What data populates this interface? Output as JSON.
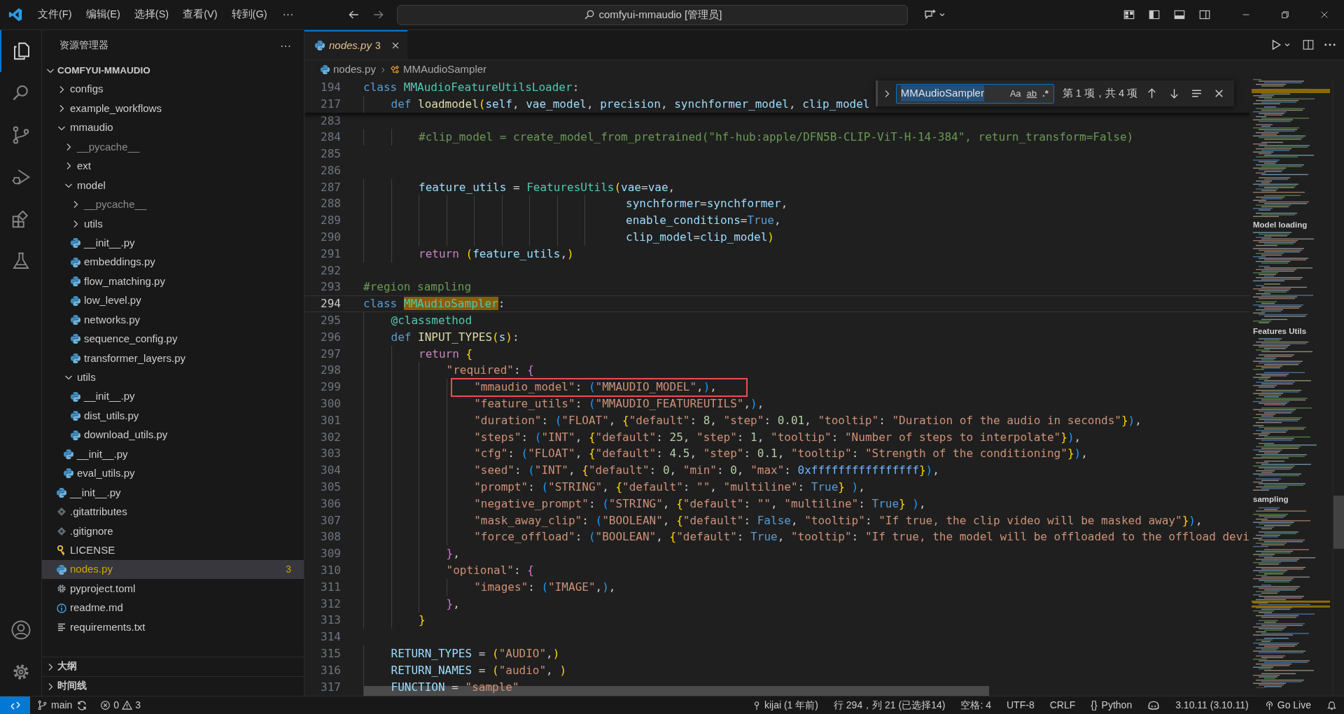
{
  "title_bar": {
    "menus": [
      "文件(F)",
      "编辑(E)",
      "选择(S)",
      "查看(V)",
      "转到(G)"
    ],
    "more": "···",
    "command_center": "comfyui-mmaudio [管理员]"
  },
  "explorer": {
    "title": "资源管理器",
    "more": "···",
    "root": {
      "label": "COMFYUI-MMAUDIO",
      "expanded": true
    },
    "tree": [
      {
        "label": "configs",
        "kind": "folder",
        "expanded": false,
        "dimmed": false,
        "selected": false
      },
      {
        "label": "example_workflows",
        "kind": "folder",
        "expanded": false,
        "dimmed": false,
        "selected": false
      },
      {
        "label": "mmaudio",
        "kind": "folder",
        "expanded": true,
        "dimmed": false,
        "selected": false,
        "children": [
          {
            "label": "__pycache__",
            "kind": "folder",
            "expanded": false,
            "dimmed": true,
            "selected": false
          },
          {
            "label": "ext",
            "kind": "folder",
            "expanded": false,
            "dimmed": false,
            "selected": false
          },
          {
            "label": "model",
            "kind": "folder",
            "expanded": true,
            "dimmed": false,
            "selected": false,
            "children": [
              {
                "label": "__pycache__",
                "kind": "folder",
                "expanded": false,
                "dimmed": true,
                "selected": false
              },
              {
                "label": "utils",
                "kind": "folder",
                "expanded": false,
                "dimmed": false,
                "selected": false
              },
              {
                "label": "__init__.py",
                "kind": "python",
                "dimmed": false,
                "selected": false
              },
              {
                "label": "embeddings.py",
                "kind": "python",
                "dimmed": false,
                "selected": false
              },
              {
                "label": "flow_matching.py",
                "kind": "python",
                "dimmed": false,
                "selected": false
              },
              {
                "label": "low_level.py",
                "kind": "python",
                "dimmed": false,
                "selected": false
              },
              {
                "label": "networks.py",
                "kind": "python",
                "dimmed": false,
                "selected": false
              },
              {
                "label": "sequence_config.py",
                "kind": "python",
                "dimmed": false,
                "selected": false
              },
              {
                "label": "transformer_layers.py",
                "kind": "python",
                "dimmed": false,
                "selected": false
              }
            ]
          },
          {
            "label": "utils",
            "kind": "folder",
            "expanded": true,
            "dimmed": false,
            "selected": false,
            "children": [
              {
                "label": "__init__.py",
                "kind": "python",
                "dimmed": false,
                "selected": false
              },
              {
                "label": "dist_utils.py",
                "kind": "python",
                "dimmed": false,
                "selected": false
              },
              {
                "label": "download_utils.py",
                "kind": "python",
                "dimmed": false,
                "selected": false
              }
            ]
          },
          {
            "label": "__init__.py",
            "kind": "python",
            "dimmed": false,
            "selected": false
          },
          {
            "label": "eval_utils.py",
            "kind": "python",
            "dimmed": false,
            "selected": false
          }
        ]
      },
      {
        "label": "__init__.py",
        "kind": "python",
        "dimmed": false,
        "selected": false
      },
      {
        "label": ".gitattributes",
        "kind": "git",
        "dimmed": false,
        "selected": false
      },
      {
        "label": ".gitignore",
        "kind": "git",
        "dimmed": false,
        "selected": false
      },
      {
        "label": "LICENSE",
        "kind": "license",
        "dimmed": false,
        "selected": false
      },
      {
        "label": "nodes.py",
        "kind": "python",
        "dimmed": false,
        "selected": true,
        "badge": "3"
      },
      {
        "label": "pyproject.toml",
        "kind": "config",
        "dimmed": false,
        "selected": false
      },
      {
        "label": "readme.md",
        "kind": "info",
        "dimmed": false,
        "selected": false
      },
      {
        "label": "requirements.txt",
        "kind": "text",
        "dimmed": false,
        "selected": false
      }
    ],
    "sections": [
      {
        "label": "大纲",
        "expanded": false
      },
      {
        "label": "时间线",
        "expanded": false
      }
    ]
  },
  "tabs": [
    {
      "label": "nodes.py",
      "count": "3",
      "preview": true,
      "selected": true
    }
  ],
  "breadcrumb": [
    {
      "label": "nodes.py",
      "kind": "file"
    },
    {
      "label": "MMAudioSampler",
      "kind": "class"
    }
  ],
  "find_widget": {
    "query": "MMAudioSampler",
    "query_selected": true,
    "options": [
      "Aa",
      "ab",
      ".*"
    ],
    "result": "第 1 项，共 4 项"
  },
  "editor": {
    "sticky_lines": [
      {
        "number": "194",
        "active": false,
        "tokens": [
          {
            "kind": "kw",
            "text": "class "
          },
          {
            "kind": "type",
            "text": "MMAudioFeatureUtilsLoader"
          },
          {
            "kind": "pun",
            "text": ":"
          }
        ]
      },
      {
        "number": "217",
        "active": false,
        "tokens": [
          {
            "kind": "kw",
            "text": "    def "
          },
          {
            "kind": "fn",
            "text": "loadmodel"
          },
          {
            "kind": "br1",
            "text": "("
          },
          {
            "kind": "var",
            "text": "self"
          },
          {
            "kind": "pun",
            "text": ", "
          },
          {
            "kind": "var",
            "text": "vae_model"
          },
          {
            "kind": "pun",
            "text": ", "
          },
          {
            "kind": "var",
            "text": "precision"
          },
          {
            "kind": "pun",
            "text": ", "
          },
          {
            "kind": "var",
            "text": "synchformer_model"
          },
          {
            "kind": "pun",
            "text": ", "
          },
          {
            "kind": "var",
            "text": "clip_model"
          }
        ]
      }
    ],
    "lines": [
      {
        "number": "283",
        "active": false
      },
      {
        "number": "284",
        "active": false,
        "tokens": [
          {
            "kind": "com",
            "text": "        #clip_model = create_model_from_pretrained(\"hf-hub:apple/DFN5B-CLIP-ViT-H-14-384\", return_transform=False)"
          }
        ]
      },
      {
        "number": "285",
        "active": false
      },
      {
        "number": "286",
        "active": false
      },
      {
        "number": "287",
        "active": false,
        "tokens": [
          {
            "kind": "var",
            "text": "        feature_utils"
          },
          {
            "kind": "pun",
            "text": " = "
          },
          {
            "kind": "type",
            "text": "FeaturesUtils"
          },
          {
            "kind": "br1",
            "text": "("
          },
          {
            "kind": "var",
            "text": "vae"
          },
          {
            "kind": "pun",
            "text": "="
          },
          {
            "kind": "var",
            "text": "vae"
          },
          {
            "kind": "pun",
            "text": ","
          }
        ]
      },
      {
        "number": "288",
        "active": false,
        "tokens": [
          {
            "kind": "var",
            "text": "                                      synchformer"
          },
          {
            "kind": "pun",
            "text": "="
          },
          {
            "kind": "var",
            "text": "synchformer"
          },
          {
            "kind": "pun",
            "text": ","
          }
        ]
      },
      {
        "number": "289",
        "active": false,
        "tokens": [
          {
            "kind": "var",
            "text": "                                      enable_conditions"
          },
          {
            "kind": "pun",
            "text": "="
          },
          {
            "kind": "kw",
            "text": "True"
          },
          {
            "kind": "pun",
            "text": ","
          }
        ]
      },
      {
        "number": "290",
        "active": false,
        "tokens": [
          {
            "kind": "var",
            "text": "                                      clip_model"
          },
          {
            "kind": "pun",
            "text": "="
          },
          {
            "kind": "var",
            "text": "clip_model"
          },
          {
            "kind": "br1",
            "text": ")"
          }
        ]
      },
      {
        "number": "291",
        "active": false,
        "tokens": [
          {
            "kind": "ctl",
            "text": "        return "
          },
          {
            "kind": "br1",
            "text": "("
          },
          {
            "kind": "var",
            "text": "feature_utils"
          },
          {
            "kind": "pun",
            "text": ","
          },
          {
            "kind": "br1",
            "text": ")"
          }
        ]
      },
      {
        "number": "292",
        "active": false
      },
      {
        "number": "293",
        "active": false,
        "tokens": [
          {
            "kind": "com",
            "text": "#region sampling"
          }
        ]
      },
      {
        "number": "294",
        "active": true,
        "tokens": [
          {
            "kind": "kw",
            "text": "class "
          },
          {
            "kind": "match",
            "text": "MMAudioSampler"
          },
          {
            "kind": "pun",
            "text": ":"
          }
        ]
      },
      {
        "number": "295",
        "active": false,
        "tokens": [
          {
            "kind": "type",
            "text": "    @classmethod"
          }
        ]
      },
      {
        "number": "296",
        "active": false,
        "tokens": [
          {
            "kind": "kw",
            "text": "    def "
          },
          {
            "kind": "fn",
            "text": "INPUT_TYPES"
          },
          {
            "kind": "br1",
            "text": "("
          },
          {
            "kind": "var",
            "text": "s"
          },
          {
            "kind": "br1",
            "text": ")"
          },
          {
            "kind": "pun",
            "text": ":"
          }
        ]
      },
      {
        "number": "297",
        "active": false,
        "tokens": [
          {
            "kind": "ctl",
            "text": "        return "
          },
          {
            "kind": "br1",
            "text": "{"
          }
        ]
      },
      {
        "number": "298",
        "active": false,
        "tokens": [
          {
            "kind": "str",
            "text": "            \"required\""
          },
          {
            "kind": "pun",
            "text": ": "
          },
          {
            "kind": "br2",
            "text": "{"
          }
        ]
      },
      {
        "number": "299",
        "active": false,
        "tokens": [
          {
            "kind": "str",
            "text": "                \"mmaudio_model\""
          },
          {
            "kind": "pun",
            "text": ": "
          },
          {
            "kind": "br3",
            "text": "("
          },
          {
            "kind": "str",
            "text": "\"MMAUDIO_MODEL\""
          },
          {
            "kind": "pun",
            "text": ","
          },
          {
            "kind": "br3",
            "text": ")"
          },
          {
            "kind": "pun",
            "text": ","
          }
        ]
      },
      {
        "number": "300",
        "active": false,
        "tokens": [
          {
            "kind": "str",
            "text": "                \"feature_utils\""
          },
          {
            "kind": "pun",
            "text": ": "
          },
          {
            "kind": "br3",
            "text": "("
          },
          {
            "kind": "str",
            "text": "\"MMAUDIO_FEATUREUTILS\""
          },
          {
            "kind": "pun",
            "text": ","
          },
          {
            "kind": "br3",
            "text": ")"
          },
          {
            "kind": "pun",
            "text": ","
          }
        ]
      },
      {
        "number": "301",
        "active": false,
        "tokens": [
          {
            "kind": "str",
            "text": "                \"duration\""
          },
          {
            "kind": "pun",
            "text": ": "
          },
          {
            "kind": "br3",
            "text": "("
          },
          {
            "kind": "str",
            "text": "\"FLOAT\""
          },
          {
            "kind": "pun",
            "text": ", "
          },
          {
            "kind": "br1",
            "text": "{"
          },
          {
            "kind": "str",
            "text": "\"default\""
          },
          {
            "kind": "pun",
            "text": ": "
          },
          {
            "kind": "num",
            "text": "8"
          },
          {
            "kind": "pun",
            "text": ", "
          },
          {
            "kind": "str",
            "text": "\"step\""
          },
          {
            "kind": "pun",
            "text": ": "
          },
          {
            "kind": "num",
            "text": "0.01"
          },
          {
            "kind": "pun",
            "text": ", "
          },
          {
            "kind": "str",
            "text": "\"tooltip\""
          },
          {
            "kind": "pun",
            "text": ": "
          },
          {
            "kind": "str",
            "text": "\"Duration of the audio in seconds\""
          },
          {
            "kind": "br1",
            "text": "}"
          },
          {
            "kind": "br3",
            "text": ")"
          },
          {
            "kind": "pun",
            "text": ","
          }
        ]
      },
      {
        "number": "302",
        "active": false,
        "tokens": [
          {
            "kind": "str",
            "text": "                \"steps\""
          },
          {
            "kind": "pun",
            "text": ": "
          },
          {
            "kind": "br3",
            "text": "("
          },
          {
            "kind": "str",
            "text": "\"INT\""
          },
          {
            "kind": "pun",
            "text": ", "
          },
          {
            "kind": "br1",
            "text": "{"
          },
          {
            "kind": "str",
            "text": "\"default\""
          },
          {
            "kind": "pun",
            "text": ": "
          },
          {
            "kind": "num",
            "text": "25"
          },
          {
            "kind": "pun",
            "text": ", "
          },
          {
            "kind": "str",
            "text": "\"step\""
          },
          {
            "kind": "pun",
            "text": ": "
          },
          {
            "kind": "num",
            "text": "1"
          },
          {
            "kind": "pun",
            "text": ", "
          },
          {
            "kind": "str",
            "text": "\"tooltip\""
          },
          {
            "kind": "pun",
            "text": ": "
          },
          {
            "kind": "str",
            "text": "\"Number of steps to interpolate\""
          },
          {
            "kind": "br1",
            "text": "}"
          },
          {
            "kind": "br3",
            "text": ")"
          },
          {
            "kind": "pun",
            "text": ","
          }
        ]
      },
      {
        "number": "303",
        "active": false,
        "tokens": [
          {
            "kind": "str",
            "text": "                \"cfg\""
          },
          {
            "kind": "pun",
            "text": ": "
          },
          {
            "kind": "br3",
            "text": "("
          },
          {
            "kind": "str",
            "text": "\"FLOAT\""
          },
          {
            "kind": "pun",
            "text": ", "
          },
          {
            "kind": "br1",
            "text": "{"
          },
          {
            "kind": "str",
            "text": "\"default\""
          },
          {
            "kind": "pun",
            "text": ": "
          },
          {
            "kind": "num",
            "text": "4.5"
          },
          {
            "kind": "pun",
            "text": ", "
          },
          {
            "kind": "str",
            "text": "\"step\""
          },
          {
            "kind": "pun",
            "text": ": "
          },
          {
            "kind": "num",
            "text": "0.1"
          },
          {
            "kind": "pun",
            "text": ", "
          },
          {
            "kind": "str",
            "text": "\"tooltip\""
          },
          {
            "kind": "pun",
            "text": ": "
          },
          {
            "kind": "str",
            "text": "\"Strength of the conditioning\""
          },
          {
            "kind": "br1",
            "text": "}"
          },
          {
            "kind": "br3",
            "text": ")"
          },
          {
            "kind": "pun",
            "text": ","
          }
        ]
      },
      {
        "number": "304",
        "active": false,
        "tokens": [
          {
            "kind": "str",
            "text": "                \"seed\""
          },
          {
            "kind": "pun",
            "text": ": "
          },
          {
            "kind": "br3",
            "text": "("
          },
          {
            "kind": "str",
            "text": "\"INT\""
          },
          {
            "kind": "pun",
            "text": ", "
          },
          {
            "kind": "br1",
            "text": "{"
          },
          {
            "kind": "str",
            "text": "\"default\""
          },
          {
            "kind": "pun",
            "text": ": "
          },
          {
            "kind": "num",
            "text": "0"
          },
          {
            "kind": "pun",
            "text": ", "
          },
          {
            "kind": "str",
            "text": "\"min\""
          },
          {
            "kind": "pun",
            "text": ": "
          },
          {
            "kind": "num",
            "text": "0"
          },
          {
            "kind": "pun",
            "text": ", "
          },
          {
            "kind": "str",
            "text": "\"max\""
          },
          {
            "kind": "pun",
            "text": ": "
          },
          {
            "kind": "hex",
            "text": "0xffffffffffffffff"
          },
          {
            "kind": "br1",
            "text": "}"
          },
          {
            "kind": "br3",
            "text": ")"
          },
          {
            "kind": "pun",
            "text": ","
          }
        ]
      },
      {
        "number": "305",
        "active": false,
        "tokens": [
          {
            "kind": "str",
            "text": "                \"prompt\""
          },
          {
            "kind": "pun",
            "text": ": "
          },
          {
            "kind": "br3",
            "text": "("
          },
          {
            "kind": "str",
            "text": "\"STRING\""
          },
          {
            "kind": "pun",
            "text": ", "
          },
          {
            "kind": "br1",
            "text": "{"
          },
          {
            "kind": "str",
            "text": "\"default\""
          },
          {
            "kind": "pun",
            "text": ": "
          },
          {
            "kind": "str",
            "text": "\"\""
          },
          {
            "kind": "pun",
            "text": ", "
          },
          {
            "kind": "str",
            "text": "\"multiline\""
          },
          {
            "kind": "pun",
            "text": ": "
          },
          {
            "kind": "kw",
            "text": "True"
          },
          {
            "kind": "br1",
            "text": "}"
          },
          {
            "kind": "br3",
            "text": " )"
          },
          {
            "kind": "pun",
            "text": ","
          }
        ]
      },
      {
        "number": "306",
        "active": false,
        "tokens": [
          {
            "kind": "str",
            "text": "                \"negative_prompt\""
          },
          {
            "kind": "pun",
            "text": ": "
          },
          {
            "kind": "br3",
            "text": "("
          },
          {
            "kind": "str",
            "text": "\"STRING\""
          },
          {
            "kind": "pun",
            "text": ", "
          },
          {
            "kind": "br1",
            "text": "{"
          },
          {
            "kind": "str",
            "text": "\"default\""
          },
          {
            "kind": "pun",
            "text": ": "
          },
          {
            "kind": "str",
            "text": "\"\""
          },
          {
            "kind": "pun",
            "text": ", "
          },
          {
            "kind": "str",
            "text": "\"multiline\""
          },
          {
            "kind": "pun",
            "text": ": "
          },
          {
            "kind": "kw",
            "text": "True"
          },
          {
            "kind": "br1",
            "text": "}"
          },
          {
            "kind": "br3",
            "text": " )"
          },
          {
            "kind": "pun",
            "text": ","
          }
        ]
      },
      {
        "number": "307",
        "active": false,
        "tokens": [
          {
            "kind": "str",
            "text": "                \"mask_away_clip\""
          },
          {
            "kind": "pun",
            "text": ": "
          },
          {
            "kind": "br3",
            "text": "("
          },
          {
            "kind": "str",
            "text": "\"BOOLEAN\""
          },
          {
            "kind": "pun",
            "text": ", "
          },
          {
            "kind": "br1",
            "text": "{"
          },
          {
            "kind": "str",
            "text": "\"default\""
          },
          {
            "kind": "pun",
            "text": ": "
          },
          {
            "kind": "kw",
            "text": "False"
          },
          {
            "kind": "pun",
            "text": ", "
          },
          {
            "kind": "str",
            "text": "\"tooltip\""
          },
          {
            "kind": "pun",
            "text": ": "
          },
          {
            "kind": "str",
            "text": "\"If true, the clip video will be masked away\""
          },
          {
            "kind": "br1",
            "text": "}"
          },
          {
            "kind": "br3",
            "text": ")"
          },
          {
            "kind": "pun",
            "text": ","
          }
        ]
      },
      {
        "number": "308",
        "active": false,
        "tokens": [
          {
            "kind": "str",
            "text": "                \"force_offload\""
          },
          {
            "kind": "pun",
            "text": ": "
          },
          {
            "kind": "br3",
            "text": "("
          },
          {
            "kind": "str",
            "text": "\"BOOLEAN\""
          },
          {
            "kind": "pun",
            "text": ", "
          },
          {
            "kind": "br1",
            "text": "{"
          },
          {
            "kind": "str",
            "text": "\"default\""
          },
          {
            "kind": "pun",
            "text": ": "
          },
          {
            "kind": "kw",
            "text": "True"
          },
          {
            "kind": "pun",
            "text": ", "
          },
          {
            "kind": "str",
            "text": "\"tooltip\""
          },
          {
            "kind": "pun",
            "text": ": "
          },
          {
            "kind": "str",
            "text": "\"If true, the model will be offloaded to the offload devi"
          }
        ]
      },
      {
        "number": "309",
        "active": false,
        "tokens": [
          {
            "kind": "br2",
            "text": "            }"
          },
          {
            "kind": "pun",
            "text": ","
          }
        ]
      },
      {
        "number": "310",
        "active": false,
        "tokens": [
          {
            "kind": "str",
            "text": "            \"optional\""
          },
          {
            "kind": "pun",
            "text": ": "
          },
          {
            "kind": "br2",
            "text": "{"
          }
        ]
      },
      {
        "number": "311",
        "active": false,
        "tokens": [
          {
            "kind": "str",
            "text": "                \"images\""
          },
          {
            "kind": "pun",
            "text": ": "
          },
          {
            "kind": "br3",
            "text": "("
          },
          {
            "kind": "str",
            "text": "\"IMAGE\""
          },
          {
            "kind": "pun",
            "text": ","
          },
          {
            "kind": "br3",
            "text": ")"
          },
          {
            "kind": "pun",
            "text": ","
          }
        ]
      },
      {
        "number": "312",
        "active": false,
        "tokens": [
          {
            "kind": "br2",
            "text": "            }"
          },
          {
            "kind": "pun",
            "text": ","
          }
        ]
      },
      {
        "number": "313",
        "active": false,
        "tokens": [
          {
            "kind": "br1",
            "text": "        }"
          }
        ]
      },
      {
        "number": "314",
        "active": false
      },
      {
        "number": "315",
        "active": false,
        "tokens": [
          {
            "kind": "var",
            "text": "    RETURN_TYPES"
          },
          {
            "kind": "pun",
            "text": " = "
          },
          {
            "kind": "br1",
            "text": "("
          },
          {
            "kind": "str",
            "text": "\"AUDIO\""
          },
          {
            "kind": "pun",
            "text": ","
          },
          {
            "kind": "br1",
            "text": ")"
          }
        ]
      },
      {
        "number": "316",
        "active": false,
        "tokens": [
          {
            "kind": "var",
            "text": "    RETURN_NAMES"
          },
          {
            "kind": "pun",
            "text": " = "
          },
          {
            "kind": "br1",
            "text": "("
          },
          {
            "kind": "str",
            "text": "\"audio\""
          },
          {
            "kind": "pun",
            "text": ", "
          },
          {
            "kind": "br1",
            "text": ")"
          }
        ]
      },
      {
        "number": "317",
        "active": false,
        "tokens": [
          {
            "kind": "var",
            "text": "    FUNCTION"
          },
          {
            "kind": "pun",
            "text": " = "
          },
          {
            "kind": "str",
            "text": "\"sample\""
          }
        ]
      }
    ],
    "minimap": {
      "sections": [
        "Model loading",
        "Features Utils",
        "sampling"
      ]
    }
  },
  "status_bar": {
    "branch": "main",
    "errors": "0",
    "warnings": "3",
    "blame": "kijai (1 年前)",
    "position": "行 294，列 21 (已选择14)",
    "indentation": "空格: 4",
    "encoding": "UTF-8",
    "eol": "CRLF",
    "language_icon": "{}",
    "language": "Python",
    "interpreter": "3.10.11 (3.10.11)",
    "live_server": "Go Live"
  }
}
